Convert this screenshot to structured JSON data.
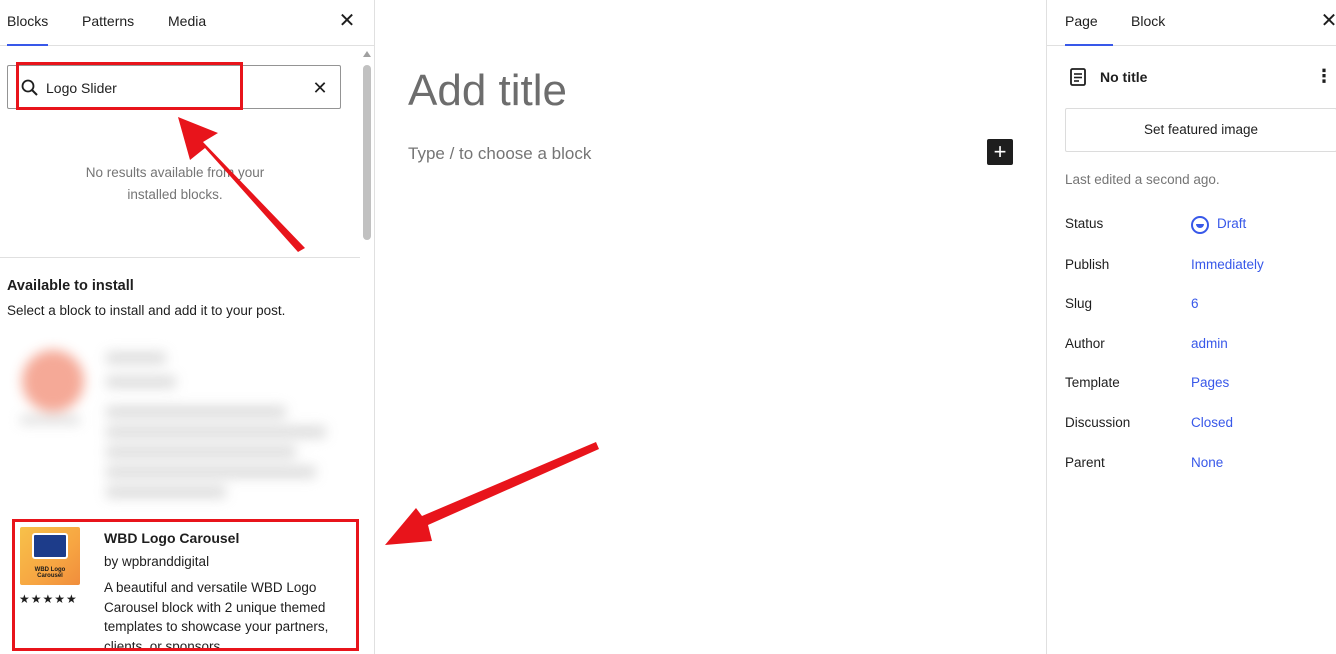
{
  "inserter": {
    "tabs": [
      "Blocks",
      "Patterns",
      "Media"
    ],
    "active_tab": "Blocks",
    "close_icon": "close-icon",
    "search": {
      "value": "Logo Slider",
      "icon": "search-icon",
      "clear_icon": "clear-icon"
    },
    "no_results_line1": "No results available from your",
    "no_results_line2": "installed blocks.",
    "available_title": "Available to install",
    "available_subtitle": "Select a block to install and add it to your post.",
    "plugin": {
      "name": "WBD Logo Carousel",
      "author": "by wpbranddigital",
      "icon_text": "WBD Logo Carousel",
      "stars": "★★★★★",
      "rating": 5,
      "description": "A beautiful and versatile WBD Logo Carousel block with 2 unique themed templates to showcase your partners, clients, or sponsors."
    }
  },
  "editor": {
    "title_placeholder": "Add title",
    "block_placeholder": "Type / to choose a block",
    "add_block_icon": "plus-icon",
    "add_block_symbol": "+"
  },
  "settings": {
    "tabs": [
      "Page",
      "Block"
    ],
    "active_tab": "Page",
    "close_icon": "close-icon",
    "doc_title": "No title",
    "featured_image_label": "Set featured image",
    "last_edited": "Last edited a second ago.",
    "rows": [
      {
        "label": "Status",
        "value": "Draft"
      },
      {
        "label": "Publish",
        "value": "Immediately"
      },
      {
        "label": "Slug",
        "value": "6"
      },
      {
        "label": "Author",
        "value": "admin"
      },
      {
        "label": "Template",
        "value": "Pages"
      },
      {
        "label": "Discussion",
        "value": "Closed"
      },
      {
        "label": "Parent",
        "value": "None"
      }
    ]
  },
  "annotation_color": "#e8141b",
  "accent_color": "#3858e9"
}
